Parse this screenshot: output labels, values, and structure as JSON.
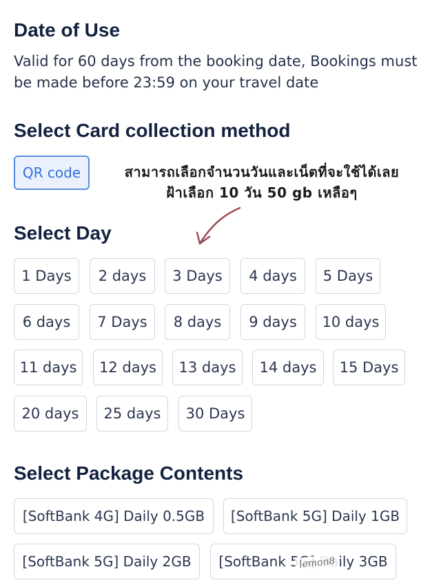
{
  "date_of_use": {
    "title": "Date of Use",
    "description": "Valid for 60 days from the booking date, Bookings must be made before 23:59 on your travel date"
  },
  "collection": {
    "title": "Select Card collection method",
    "qr_label": "QR code"
  },
  "annotation": {
    "line1": "สามารถเลือกจำนวนวันและเน็ตที่จะใช้ได้เลย",
    "line2": "ฝ้าเลือก 10 วัน 50 gb เหลือๆ"
  },
  "day": {
    "title": "Select Day",
    "options": [
      "1 Days",
      "2 days",
      "3 Days",
      "4 days",
      "5 Days",
      "6 days",
      "7 Days",
      "8 days",
      "9 days",
      "10 days",
      "11 days",
      "12 days",
      "13 days",
      "14 days",
      "15 Days",
      "20 days",
      "25 days",
      "30 Days"
    ]
  },
  "package": {
    "title": "Select Package Contents",
    "options": [
      "[SoftBank 4G] Daily 0.5GB",
      "[SoftBank 5G] Daily 1GB",
      "[SoftBank 5G] Daily 2GB",
      "[SoftBank 5G] Daily 3GB"
    ]
  },
  "watermark": {
    "brand": "lemon8"
  },
  "icons": {
    "annotation_arrow": "hand-drawn-arrow-icon"
  },
  "colors": {
    "heading": "#12213f",
    "accent": "#2f6fd8",
    "accent_bg": "#eaf1fd",
    "chip_border": "#cfd6df",
    "arrow": "#9b4a55"
  }
}
